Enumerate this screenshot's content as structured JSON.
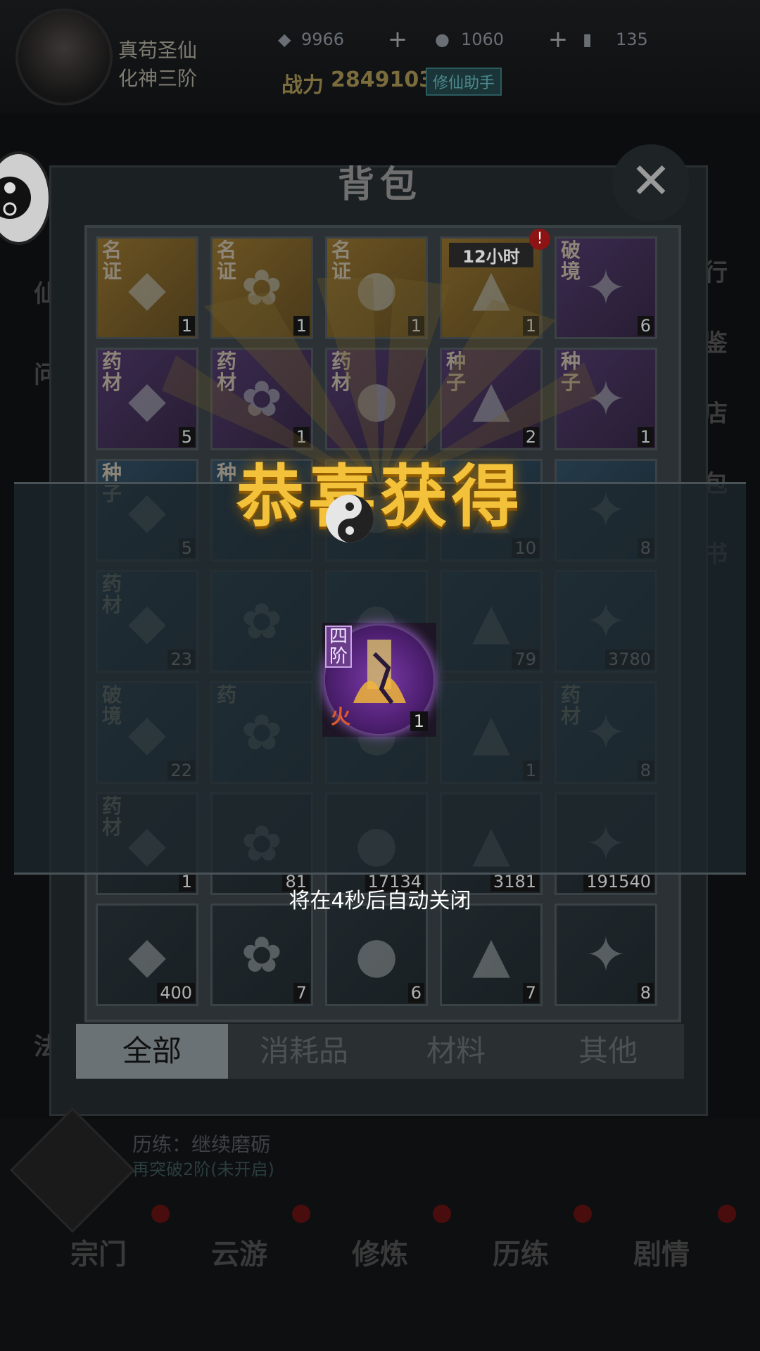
{
  "hud": {
    "player_name": "真苟圣仙",
    "realm": "化神三阶",
    "stone": "9966",
    "jade": "1060",
    "ticket": "135",
    "power_label": "战力",
    "power_value": "2849103",
    "helper": "修仙助手"
  },
  "bag": {
    "title": "背包",
    "close": "✕",
    "cells": [
      {
        "tag": "名证",
        "count": "1",
        "color": "gold"
      },
      {
        "tag": "名证",
        "count": "1",
        "color": "gold"
      },
      {
        "tag": "名证",
        "count": "1",
        "color": "gold"
      },
      {
        "tag": "",
        "count": "1",
        "color": "gold",
        "timer": "12小时",
        "alert": "!"
      },
      {
        "tag": "破境",
        "count": "6",
        "color": "purp"
      },
      {
        "tag": "药材",
        "count": "5",
        "color": "purp"
      },
      {
        "tag": "药材",
        "count": "1",
        "color": "purp"
      },
      {
        "tag": "药材",
        "count": "",
        "color": "purp"
      },
      {
        "tag": "种子",
        "count": "2",
        "color": "purp"
      },
      {
        "tag": "种子",
        "count": "1",
        "color": "purp"
      },
      {
        "tag": "种子",
        "count": "5",
        "color": "blue"
      },
      {
        "tag": "种",
        "count": "",
        "color": "blue"
      },
      {
        "tag": "",
        "count": "",
        "color": "blue"
      },
      {
        "tag": "",
        "count": "10",
        "color": "blue"
      },
      {
        "tag": "",
        "count": "8",
        "color": "blue"
      },
      {
        "tag": "药材",
        "count": "23",
        "color": "blue"
      },
      {
        "tag": "",
        "count": "",
        "color": "blue"
      },
      {
        "tag": "",
        "count": "",
        "color": "blue"
      },
      {
        "tag": "",
        "count": "79",
        "color": "blue"
      },
      {
        "tag": "",
        "count": "3780",
        "color": "blue"
      },
      {
        "tag": "破境",
        "count": "22",
        "color": "blue"
      },
      {
        "tag": "药",
        "count": "",
        "color": "blue"
      },
      {
        "tag": "",
        "count": "",
        "color": "blue"
      },
      {
        "tag": "",
        "count": "1",
        "color": "blue"
      },
      {
        "tag": "药材",
        "count": "8",
        "color": "blue"
      },
      {
        "tag": "药材",
        "count": "1",
        "color": "dark"
      },
      {
        "tag": "",
        "count": "81",
        "color": "dark"
      },
      {
        "tag": "",
        "count": "17134",
        "color": "dark"
      },
      {
        "tag": "",
        "count": "3181",
        "color": "dark"
      },
      {
        "tag": "",
        "count": "191540",
        "color": "dark"
      },
      {
        "tag": "",
        "count": "400",
        "color": "dark"
      },
      {
        "tag": "",
        "count": "7",
        "color": "dark"
      },
      {
        "tag": "",
        "count": "6",
        "color": "dark"
      },
      {
        "tag": "",
        "count": "7",
        "color": "dark"
      },
      {
        "tag": "",
        "count": "8",
        "color": "dark"
      }
    ],
    "tabs": [
      "全部",
      "消耗品",
      "材料",
      "其他"
    ]
  },
  "popup": {
    "title": "恭喜获得",
    "reward": {
      "tier": "四阶",
      "element": "火",
      "count": "1"
    },
    "auto_close": "将在4秒后自动关闭"
  },
  "bottom": {
    "status": "历练：继续磨砺",
    "sub": "再突破2阶(未开启)",
    "nav": [
      "宗门",
      "云游",
      "修炼",
      "历练",
      "剧情"
    ]
  },
  "side": {
    "left": [
      "仙",
      "问",
      "法"
    ],
    "right": [
      "行",
      "鉴",
      "店",
      "包",
      "书"
    ]
  }
}
